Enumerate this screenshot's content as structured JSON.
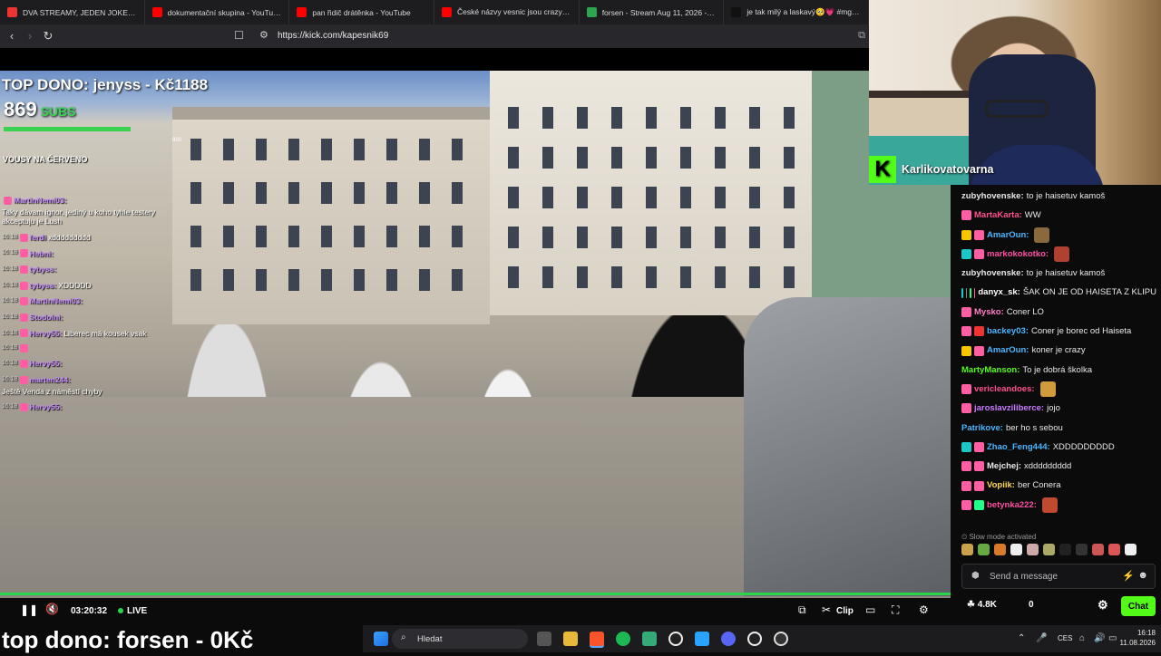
{
  "browser": {
    "tabs": [
      {
        "title": "DVA STREAMY, JEDEN JOKER. OPAK",
        "color": "#e33"
      },
      {
        "title": "dokumentační skupina - YouTube",
        "color": "#ff0000"
      },
      {
        "title": "pan řidič drátěnka - YouTube",
        "color": "#ff0000"
      },
      {
        "title": "České názvy vesnic jsou crazy 😮 #",
        "color": "#ff0000"
      },
      {
        "title": "forsen - Stream Aug 11, 2026 - Stat",
        "color": "#2ea44f"
      },
      {
        "title": "je tak milý a laskavý🥺💗 #mgfitm",
        "color": "#111"
      }
    ],
    "url": "https://kick.com/kapesnik69"
  },
  "video_overlay": {
    "top_dono": "TOP DONO: jenyss - Kč1188",
    "subs_count": "869",
    "subs_label": "SUBS",
    "bar_label": "900",
    "vousy": "VOUSY NA ČERVENO",
    "chat": [
      {
        "time": "",
        "user": "MartinNemi03:",
        "text": "Taky dávam ignor, jediný u koho tyhle testery akceptuju je Lush"
      },
      {
        "time": "16:18",
        "user": "ferdi",
        "text": "xddddddddd"
      },
      {
        "time": "16:18",
        "user": "Hebni:",
        "text": ""
      },
      {
        "time": "16:18",
        "user": "tybyss:",
        "text": ""
      },
      {
        "time": "16:18",
        "user": "tybyss:",
        "text": "XDDDDD"
      },
      {
        "time": "16:18",
        "user": "MartinNemi03:",
        "text": ""
      },
      {
        "time": "16:18",
        "user": "Stodolni:",
        "text": ""
      },
      {
        "time": "16:18",
        "user": "Hervy55:",
        "text": "Liberec má kousek vsak"
      },
      {
        "time": "16:18",
        "user": "",
        "text": ""
      },
      {
        "time": "16:18",
        "user": "Hervy55:",
        "text": ""
      },
      {
        "time": "16:18",
        "user": "marten244:",
        "text": "Ještě Venda z náměstí chyby"
      },
      {
        "time": "16:18",
        "user": "Hervy55:",
        "text": ""
      }
    ]
  },
  "player": {
    "time": "03:20:32",
    "live": "LIVE",
    "clip_label": "Clip",
    "progress_pct": 100
  },
  "ticker": "top dono: forsen - 0Kč",
  "webcam": {
    "name": "Karlikovatovarna",
    "logo": "K"
  },
  "chat": {
    "messages": [
      {
        "user": "zubyhovenske:",
        "text": "to je haisetuv kamoš",
        "color": "#e8e8e8",
        "badges": [],
        "emote": ""
      },
      {
        "user": "MartaKarta:",
        "text": "WW",
        "color": "#ff4f8f",
        "badges": [
          "#ff5fa2"
        ],
        "emote": ""
      },
      {
        "user": "AmarOun:",
        "text": "",
        "color": "#49b6ff",
        "badges": [
          "#f7c600",
          "#ff5fa2"
        ],
        "emote": "#8a6a3c"
      },
      {
        "user": "markokokotko:",
        "text": "",
        "color": "#ff4fa0",
        "badges": [
          "#1ec7c7",
          "#ff5fa2"
        ],
        "emote": "#b04030"
      },
      {
        "user": "zubyhovenske:",
        "text": "to je haisetuv kamoš",
        "color": "#e8e8e8",
        "badges": [],
        "emote": ""
      },
      {
        "user": "danyx_sk:",
        "text": "ŠAK ON JE OD HAISETA Z KLIPU",
        "color": "#ffffff",
        "badges": [
          "#1ec7c7",
          "#888",
          "#2f8",
          "#ff5fa2"
        ],
        "emote": ""
      },
      {
        "user": "Mysko:",
        "text": "Coner LO",
        "color": "#ff7ec8",
        "badges": [
          "#ff5fa2"
        ],
        "emote": ""
      },
      {
        "user": "backey03:",
        "text": "Coner je borec od Haiseta",
        "color": "#49b6ff",
        "badges": [
          "#ff5fa2",
          "#e33"
        ],
        "emote": ""
      },
      {
        "user": "AmarOun:",
        "text": "koner je crazy",
        "color": "#49b6ff",
        "badges": [
          "#f7c600",
          "#ff5fa2"
        ],
        "emote": ""
      },
      {
        "user": "MartyManson:",
        "text": "To je dobrá školka",
        "color": "#53fc18",
        "badges": [],
        "emote": ""
      },
      {
        "user": "vericleandoes:",
        "text": "",
        "color": "#ff4f8f",
        "badges": [
          "#ff5fa2"
        ],
        "emote": "#d19a3a"
      },
      {
        "user": "jaroslavziliberce:",
        "text": "jojo",
        "color": "#c97cff",
        "badges": [
          "#ff5fa2"
        ],
        "emote": ""
      },
      {
        "user": "Patrikove:",
        "text": "ber ho s sebou",
        "color": "#49b6ff",
        "badges": [],
        "emote": ""
      },
      {
        "user": "Zhao_Feng444:",
        "text": "XDDDDDDDDD",
        "color": "#49b6ff",
        "badges": [
          "#1ec7c7",
          "#ff5fa2"
        ],
        "emote": ""
      },
      {
        "user": "Mejchej:",
        "text": "xddddddddd",
        "color": "#e8e8e8",
        "badges": [
          "#ff5fa2",
          "#ff5fa2"
        ],
        "emote": ""
      },
      {
        "user": "Vopiik:",
        "text": "ber Conera",
        "color": "#ffd84f",
        "badges": [
          "#ff5fa2",
          "#ff5fa2"
        ],
        "emote": ""
      },
      {
        "user": "betynka222:",
        "text": "",
        "color": "#ff4fa0",
        "badges": [
          "#ff5fa2",
          "#2f8"
        ],
        "emote": "#c04a30"
      }
    ],
    "slow_mode": "Slow mode activated",
    "input_placeholder": "Send a message",
    "viewers": "4.8K",
    "count": "0",
    "chat_button": "Chat"
  },
  "taskbar": {
    "search": "Hledat",
    "lang": "CES",
    "time": "16:18",
    "date": "11.08.2026"
  }
}
